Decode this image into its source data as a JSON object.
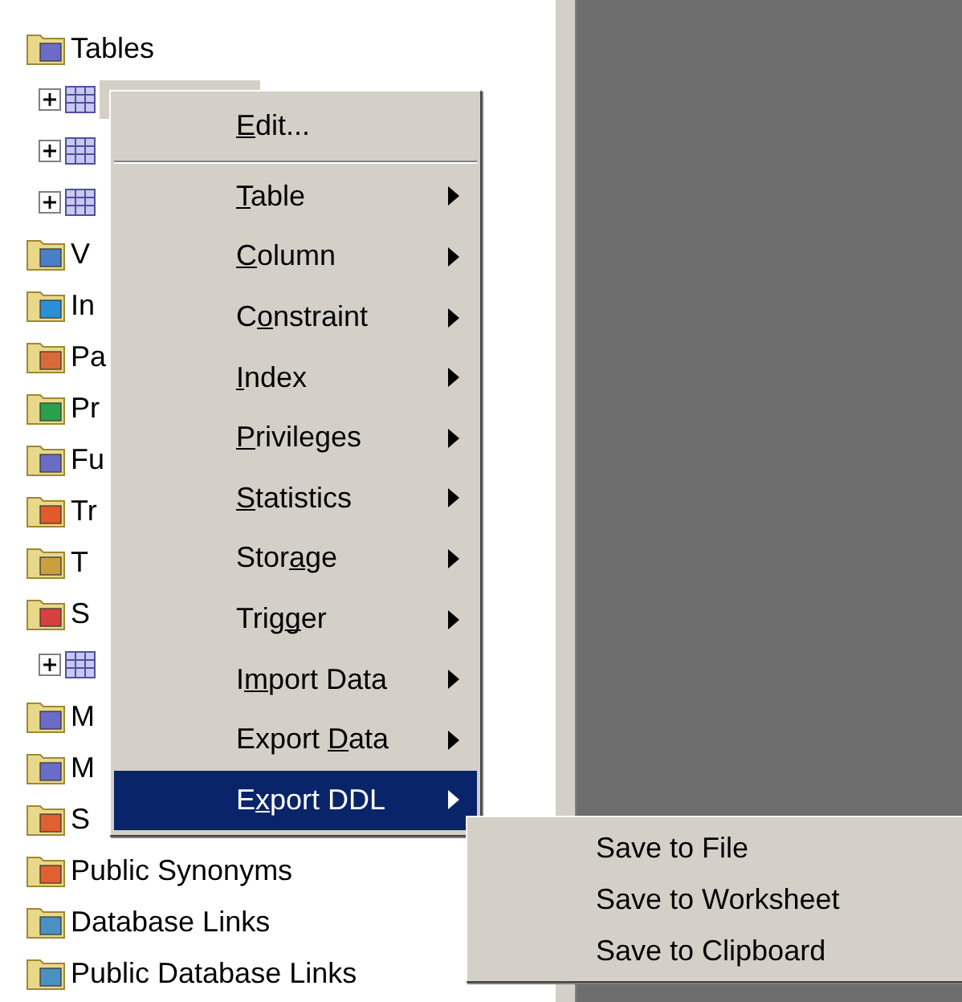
{
  "tree": {
    "items": [
      {
        "label": "Tables",
        "children": [
          {
            "selected": true,
            "expanded": false
          },
          {
            "selected": false,
            "expanded": false
          },
          {
            "selected": false,
            "expanded": false
          }
        ]
      },
      {
        "label": "V"
      },
      {
        "label": "In"
      },
      {
        "label": "Pa"
      },
      {
        "label": "Pr"
      },
      {
        "label": "Fu"
      },
      {
        "label": "Tr"
      },
      {
        "label": "T"
      },
      {
        "label": "S",
        "children": [
          {
            "selected": false,
            "expanded": false
          }
        ]
      },
      {
        "label": "M"
      },
      {
        "label": "M"
      },
      {
        "label": "S"
      },
      {
        "label": "Public Synonyms"
      },
      {
        "label": "Database Links"
      },
      {
        "label": "Public Database Links"
      }
    ]
  },
  "context_menu": {
    "items": [
      {
        "segments": [
          {
            "text": "E",
            "underlined": true
          },
          {
            "text": "dit...",
            "underlined": false
          }
        ],
        "submenu": false,
        "selected": false
      },
      {
        "segments": [
          {
            "text": "T",
            "underlined": true
          },
          {
            "text": "able",
            "underlined": false
          }
        ],
        "submenu": true,
        "selected": false
      },
      {
        "segments": [
          {
            "text": "C",
            "underlined": true
          },
          {
            "text": "olumn",
            "underlined": false
          }
        ],
        "submenu": true,
        "selected": false
      },
      {
        "segments": [
          {
            "text": "C",
            "underlined": false
          },
          {
            "text": "o",
            "underlined": true
          },
          {
            "text": "nstraint",
            "underlined": false
          }
        ],
        "submenu": true,
        "selected": false
      },
      {
        "segments": [
          {
            "text": "I",
            "underlined": true
          },
          {
            "text": "ndex",
            "underlined": false
          }
        ],
        "submenu": true,
        "selected": false
      },
      {
        "segments": [
          {
            "text": "P",
            "underlined": true
          },
          {
            "text": "rivileges",
            "underlined": false
          }
        ],
        "submenu": true,
        "selected": false
      },
      {
        "segments": [
          {
            "text": "S",
            "underlined": true
          },
          {
            "text": "tatistics",
            "underlined": false
          }
        ],
        "submenu": true,
        "selected": false
      },
      {
        "segments": [
          {
            "text": "Stor",
            "underlined": false
          },
          {
            "text": "a",
            "underlined": true
          },
          {
            "text": "ge",
            "underlined": false
          }
        ],
        "submenu": true,
        "selected": false
      },
      {
        "segments": [
          {
            "text": "Trig",
            "underlined": false
          },
          {
            "text": "g",
            "underlined": true
          },
          {
            "text": "er",
            "underlined": false
          }
        ],
        "submenu": true,
        "selected": false
      },
      {
        "segments": [
          {
            "text": "I",
            "underlined": false
          },
          {
            "text": "m",
            "underlined": true
          },
          {
            "text": "port Data",
            "underlined": false
          }
        ],
        "submenu": true,
        "selected": false
      },
      {
        "segments": [
          {
            "text": "Export ",
            "underlined": false
          },
          {
            "text": "D",
            "underlined": true
          },
          {
            "text": "ata",
            "underlined": false
          }
        ],
        "submenu": true,
        "selected": false
      },
      {
        "segments": [
          {
            "text": "E",
            "underlined": false
          },
          {
            "text": "x",
            "underlined": true
          },
          {
            "text": "port DDL",
            "underlined": false
          }
        ],
        "submenu": true,
        "selected": true
      }
    ]
  },
  "submenu": {
    "items": [
      {
        "label": "Save to File"
      },
      {
        "label": "Save to Worksheet"
      },
      {
        "label": "Save to Clipboard"
      }
    ]
  }
}
